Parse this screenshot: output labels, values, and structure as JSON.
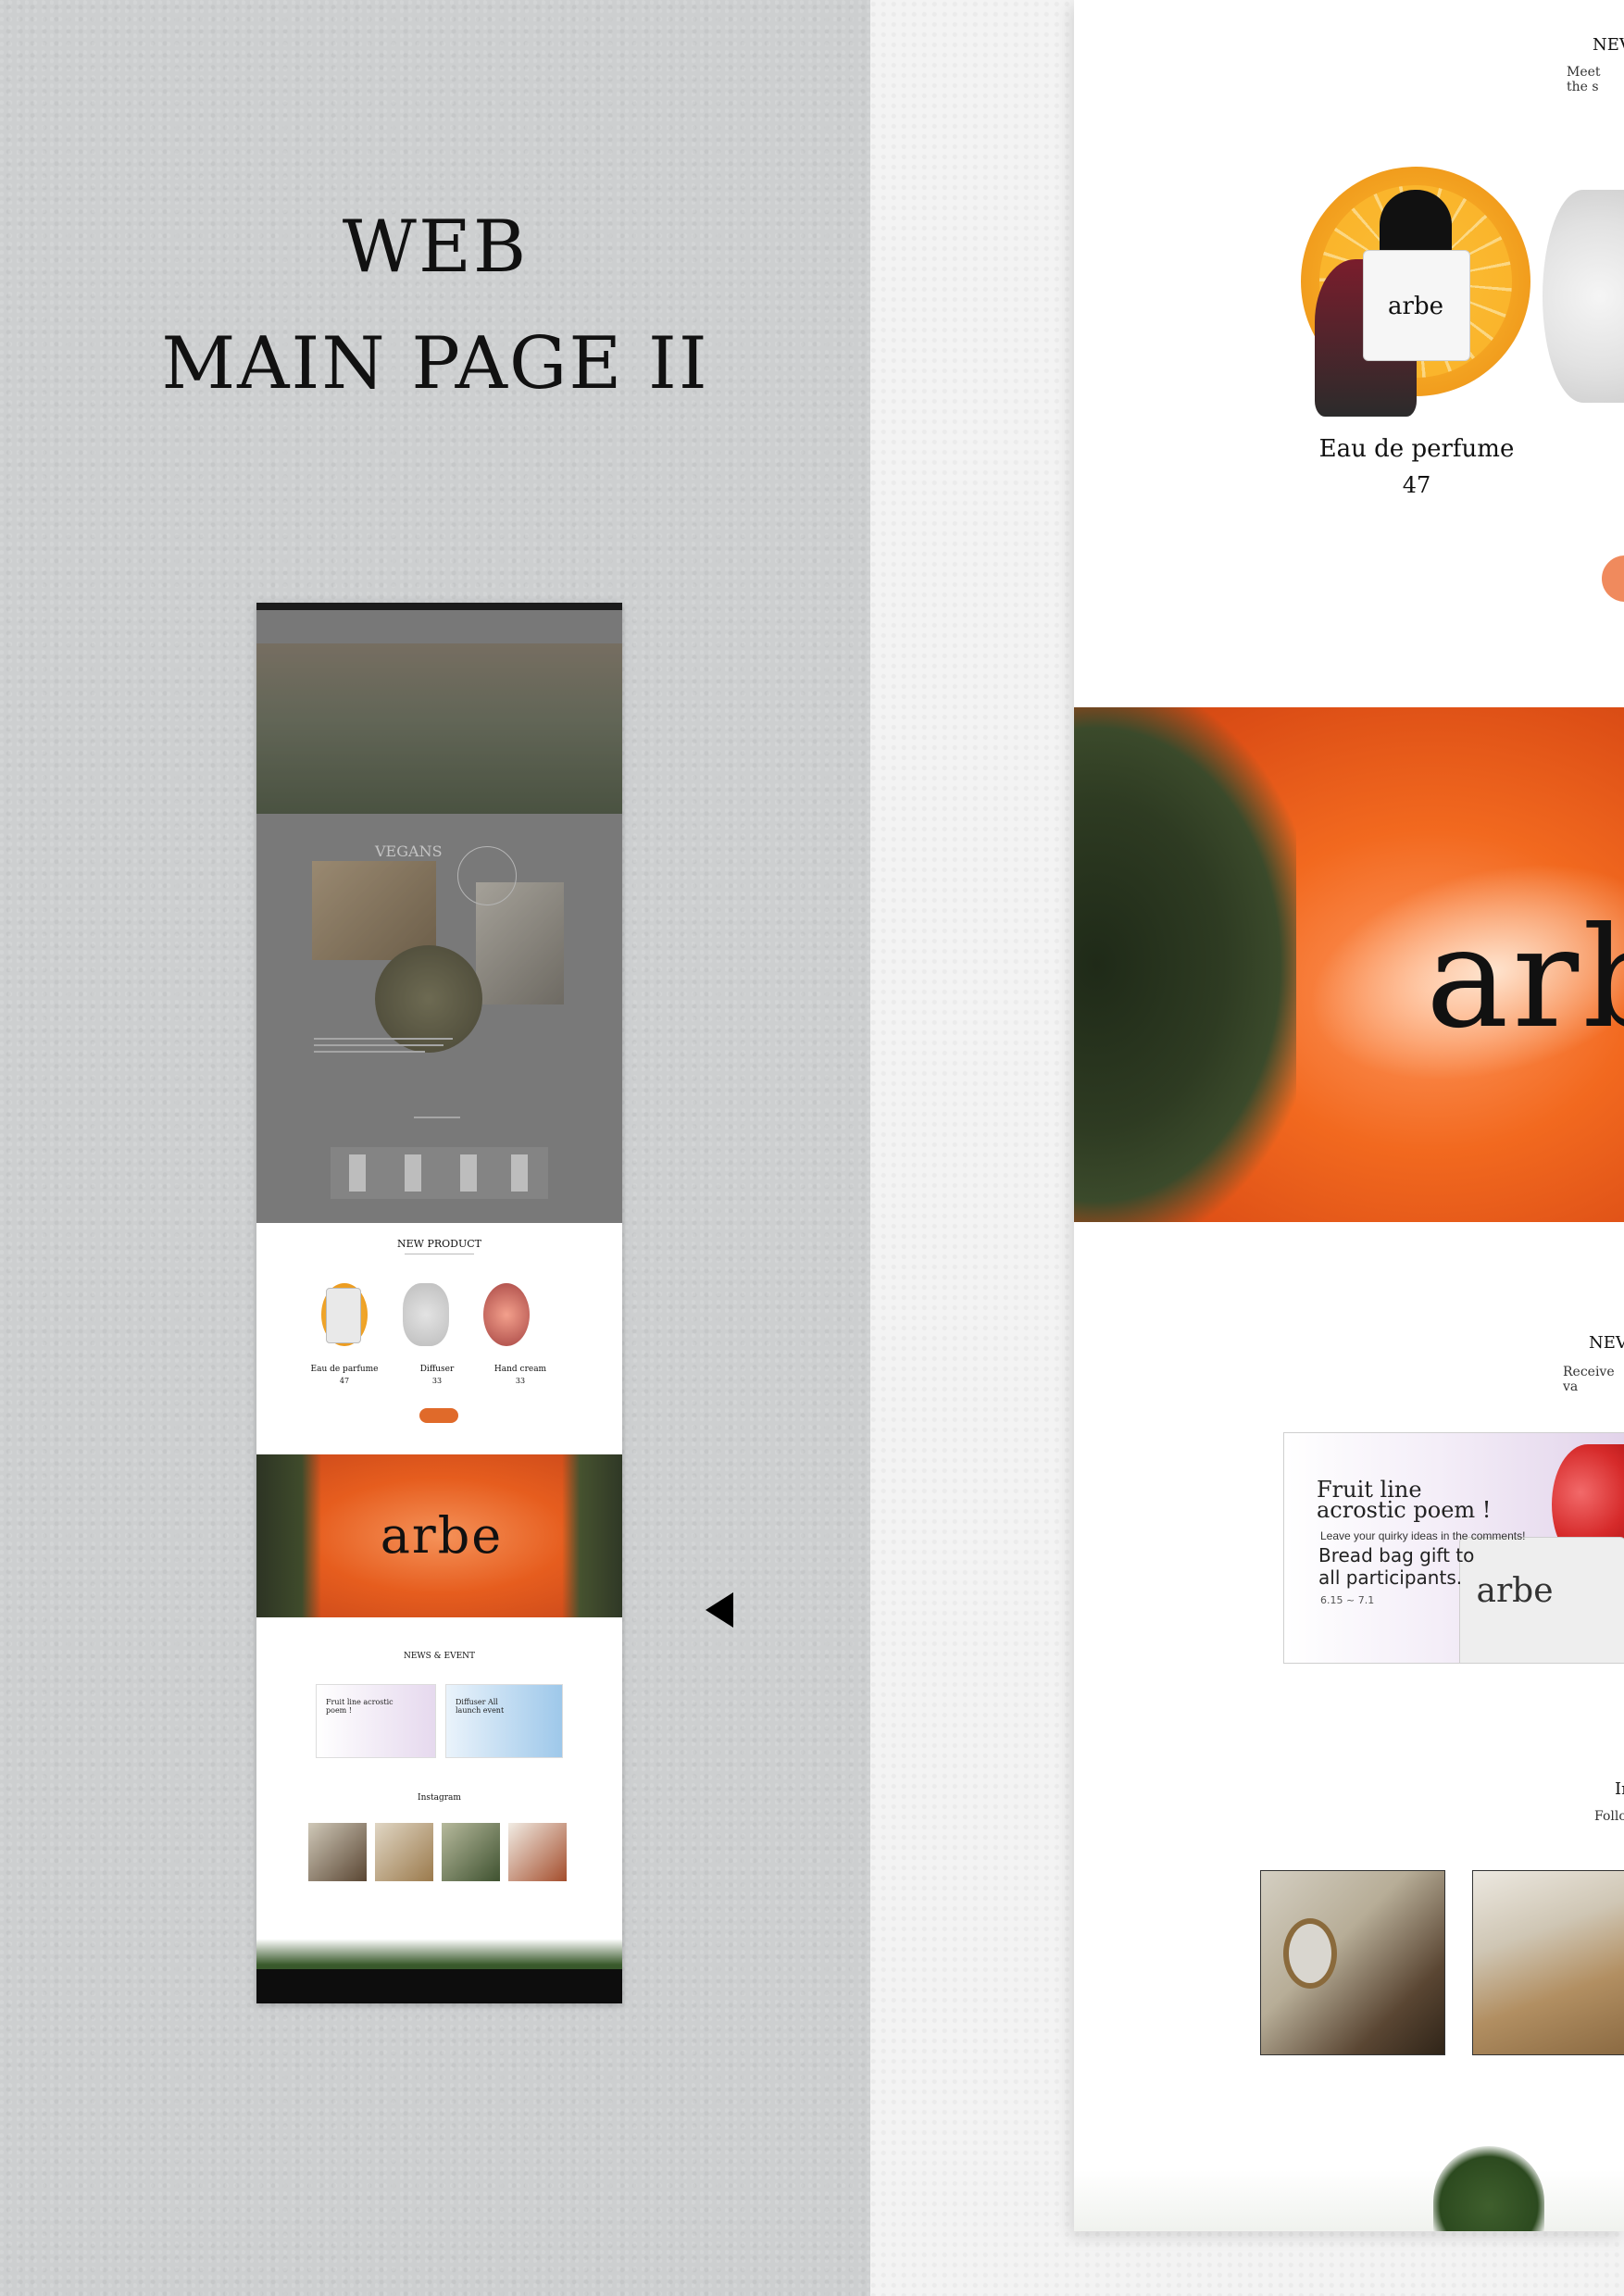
{
  "presentation": {
    "title_line1": "WEB",
    "title_line2": "MAIN PAGE II"
  },
  "thumbnail": {
    "vegans_heading": "VEGANS",
    "new_product_title": "NEW PRODUCT",
    "products": [
      {
        "name": "Eau de parfume",
        "price": "47"
      },
      {
        "name": "Diffuser",
        "price": "33"
      },
      {
        "name": "Hand cream",
        "price": "33"
      }
    ],
    "brand_logo": "arbe",
    "news_title": "NEWS & EVENT",
    "cards": [
      {
        "title": "Fruit line acrostic poem !"
      },
      {
        "title": "Diffuser All launch event"
      }
    ],
    "instagram_title": "Instagram"
  },
  "main_page": {
    "new_label": "NEV",
    "new_sub": "Meet the s",
    "product_name": "Eau de perfume",
    "product_price": "47",
    "brand_logo": "arbe",
    "news_label": "NEV",
    "news_sub": "Receive va",
    "event_card": {
      "title_line1": "Fruit line",
      "title_line2": "acrostic poem !",
      "subtitle": "Leave your quirky ideas in the comments!",
      "body_line1": "Bread bag gift to",
      "body_line2": "all participants.",
      "dates": "6.15 ~ 7.1"
    },
    "insta_label": "In",
    "insta_sub": "Follo"
  },
  "colors": {
    "left_background": "#cdcfd0",
    "accent_orange": "#e65d1e",
    "text_dark": "#111111"
  }
}
